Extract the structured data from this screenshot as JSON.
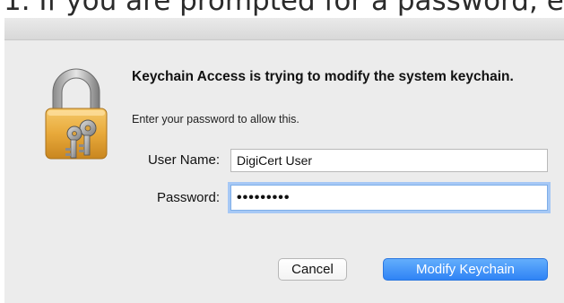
{
  "page_caption": "1. If you are prompted for a password, e",
  "dialog": {
    "heading": "Keychain Access is trying to modify the system keychain.",
    "subtext": "Enter your password to allow this.",
    "icon": "padlock-with-keys-icon",
    "fields": {
      "user_name_label": "User Name:",
      "user_name_value": "DigiCert User",
      "password_label": "Password:",
      "password_value": "•••••••••"
    },
    "buttons": {
      "cancel_label": "Cancel",
      "confirm_label": "Modify Keychain"
    },
    "colors": {
      "dialog_bg": "#ececec",
      "primary_button": "#3b8ef7",
      "focus_ring": "#a6c8f5"
    }
  }
}
